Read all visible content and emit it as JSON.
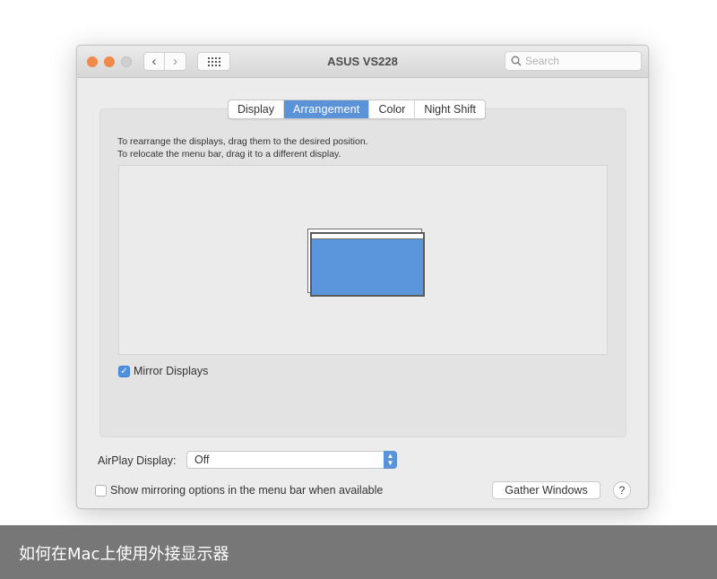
{
  "window": {
    "title": "ASUS VS228",
    "search_placeholder": "Search",
    "nav_back": "‹",
    "nav_forward": "›"
  },
  "tabs": [
    {
      "label": "Display",
      "active": false
    },
    {
      "label": "Arrangement",
      "active": true
    },
    {
      "label": "Color",
      "active": false
    },
    {
      "label": "Night Shift",
      "active": false
    }
  ],
  "arrangement": {
    "instruction_line1": "To rearrange the displays, drag them to the desired position.",
    "instruction_line2": "To relocate the menu bar, drag it to a different display.",
    "mirror_displays_label": "Mirror Displays",
    "mirror_displays_checked": true
  },
  "airplay": {
    "label": "AirPlay Display:",
    "selected": "Off"
  },
  "show_mirroring": {
    "label": "Show mirroring options in the menu bar when available",
    "checked": false
  },
  "buttons": {
    "gather_windows": "Gather Windows",
    "help": "?"
  },
  "caption": "如何在Mac上使用外接显示器",
  "colors": {
    "accent": "#5b93d9",
    "display_fill": "#5b95dc",
    "traffic_light": "#f0894a"
  }
}
